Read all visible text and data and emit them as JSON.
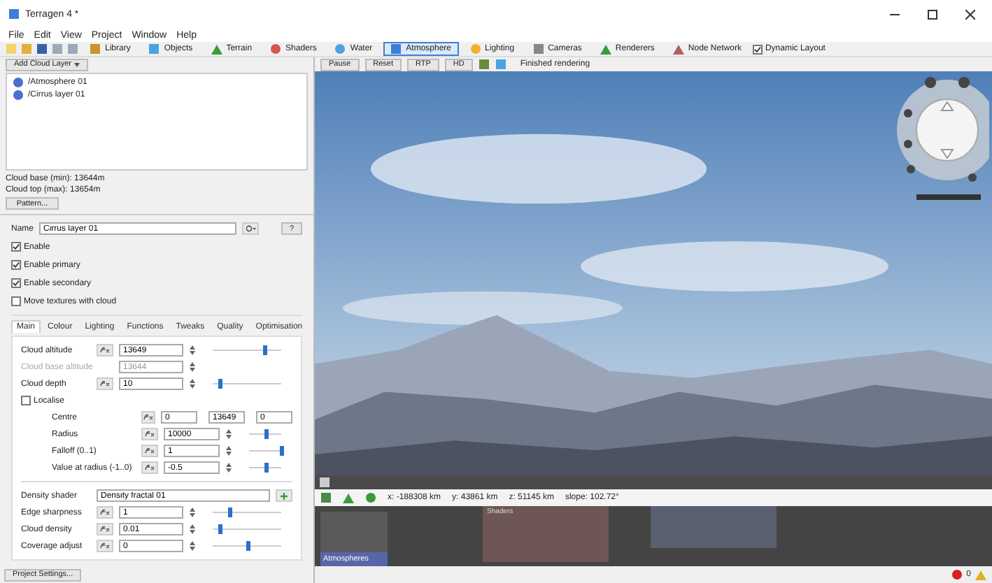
{
  "window": {
    "title": "Terragen 4 *"
  },
  "menu": [
    "File",
    "Edit",
    "View",
    "Project",
    "Window",
    "Help"
  ],
  "main_tabs": [
    {
      "label": "Library",
      "selected": false
    },
    {
      "label": "Objects",
      "selected": false
    },
    {
      "label": "Terrain",
      "selected": false
    },
    {
      "label": "Shaders",
      "selected": false
    },
    {
      "label": "Water",
      "selected": false
    },
    {
      "label": "Atmosphere",
      "selected": true
    },
    {
      "label": "Lighting",
      "selected": false
    },
    {
      "label": "Cameras",
      "selected": false
    },
    {
      "label": "Renderers",
      "selected": false
    },
    {
      "label": "Node Network",
      "selected": false
    }
  ],
  "dynamic_layout": {
    "label": "Dynamic Layout",
    "checked": true
  },
  "left_panel": {
    "add_button": "Add Cloud Layer",
    "tree": [
      {
        "label": "/Atmosphere 01"
      },
      {
        "label": "/Cirrus layer 01"
      }
    ],
    "info": [
      "Cloud base (min): 13644m",
      "Cloud top (max): 13654m"
    ],
    "pattern_button": "Pattern...",
    "name_label": "Name",
    "name_value": "Cirrus layer 01",
    "help_button": "?",
    "checkboxes": [
      {
        "label": "Enable",
        "checked": true
      },
      {
        "label": "Enable primary",
        "checked": true
      },
      {
        "label": "Enable secondary",
        "checked": true
      },
      {
        "label": "Move textures with cloud",
        "checked": false
      }
    ],
    "tabs": [
      {
        "label": "Main",
        "selected": true
      },
      {
        "label": "Colour",
        "selected": false
      },
      {
        "label": "Lighting",
        "selected": false
      },
      {
        "label": "Functions",
        "selected": false
      },
      {
        "label": "Tweaks",
        "selected": false
      },
      {
        "label": "Quality",
        "selected": false
      },
      {
        "label": "Optimisation",
        "selected": false
      }
    ],
    "params": [
      {
        "kind": "param",
        "label": "Cloud altitude",
        "value": "13649",
        "level": 0.75
      },
      {
        "kind": "readonly",
        "label": "Cloud base altitude",
        "value": "13644"
      },
      {
        "kind": "param",
        "label": "Cloud depth",
        "value": "10",
        "level": 0.1
      },
      {
        "kind": "check",
        "label": "Localise",
        "checked": false
      },
      {
        "kind": "vector",
        "label": "Centre",
        "values": [
          "0",
          "13649",
          "0"
        ]
      },
      {
        "kind": "subparam",
        "label": "Radius",
        "value": "10000",
        "level": 0.5
      },
      {
        "kind": "subparam",
        "label": "Falloff (0..1)",
        "value": "1",
        "level": 1.0
      },
      {
        "kind": "subparam",
        "label": "Value at radius (-1..0)",
        "value": "-0.5",
        "level": 0.5
      },
      {
        "kind": "divider"
      },
      {
        "kind": "shader",
        "label": "Density shader",
        "value": "Density fractal 01"
      },
      {
        "kind": "param",
        "label": "Edge sharpness",
        "value": "1",
        "level": 0.25
      },
      {
        "kind": "param",
        "label": "Cloud density",
        "value": "0.01",
        "level": 0.1
      },
      {
        "kind": "param",
        "label": "Coverage adjust",
        "value": "0",
        "level": 0.5
      }
    ],
    "project_button": "Project Settings..."
  },
  "render_toolbar": {
    "buttons": [
      "Pause",
      "Reset",
      "RTP",
      "HD"
    ],
    "status": "Finished rendering"
  },
  "coords": [
    "x: -188308 km",
    "y: 43861 km",
    "z: 51145 km",
    "slope: 102.72°"
  ],
  "node_network": {
    "sidebar_label": "Atmospheres",
    "group_label": "Shaders"
  },
  "status_bar": {
    "errors": "0"
  }
}
